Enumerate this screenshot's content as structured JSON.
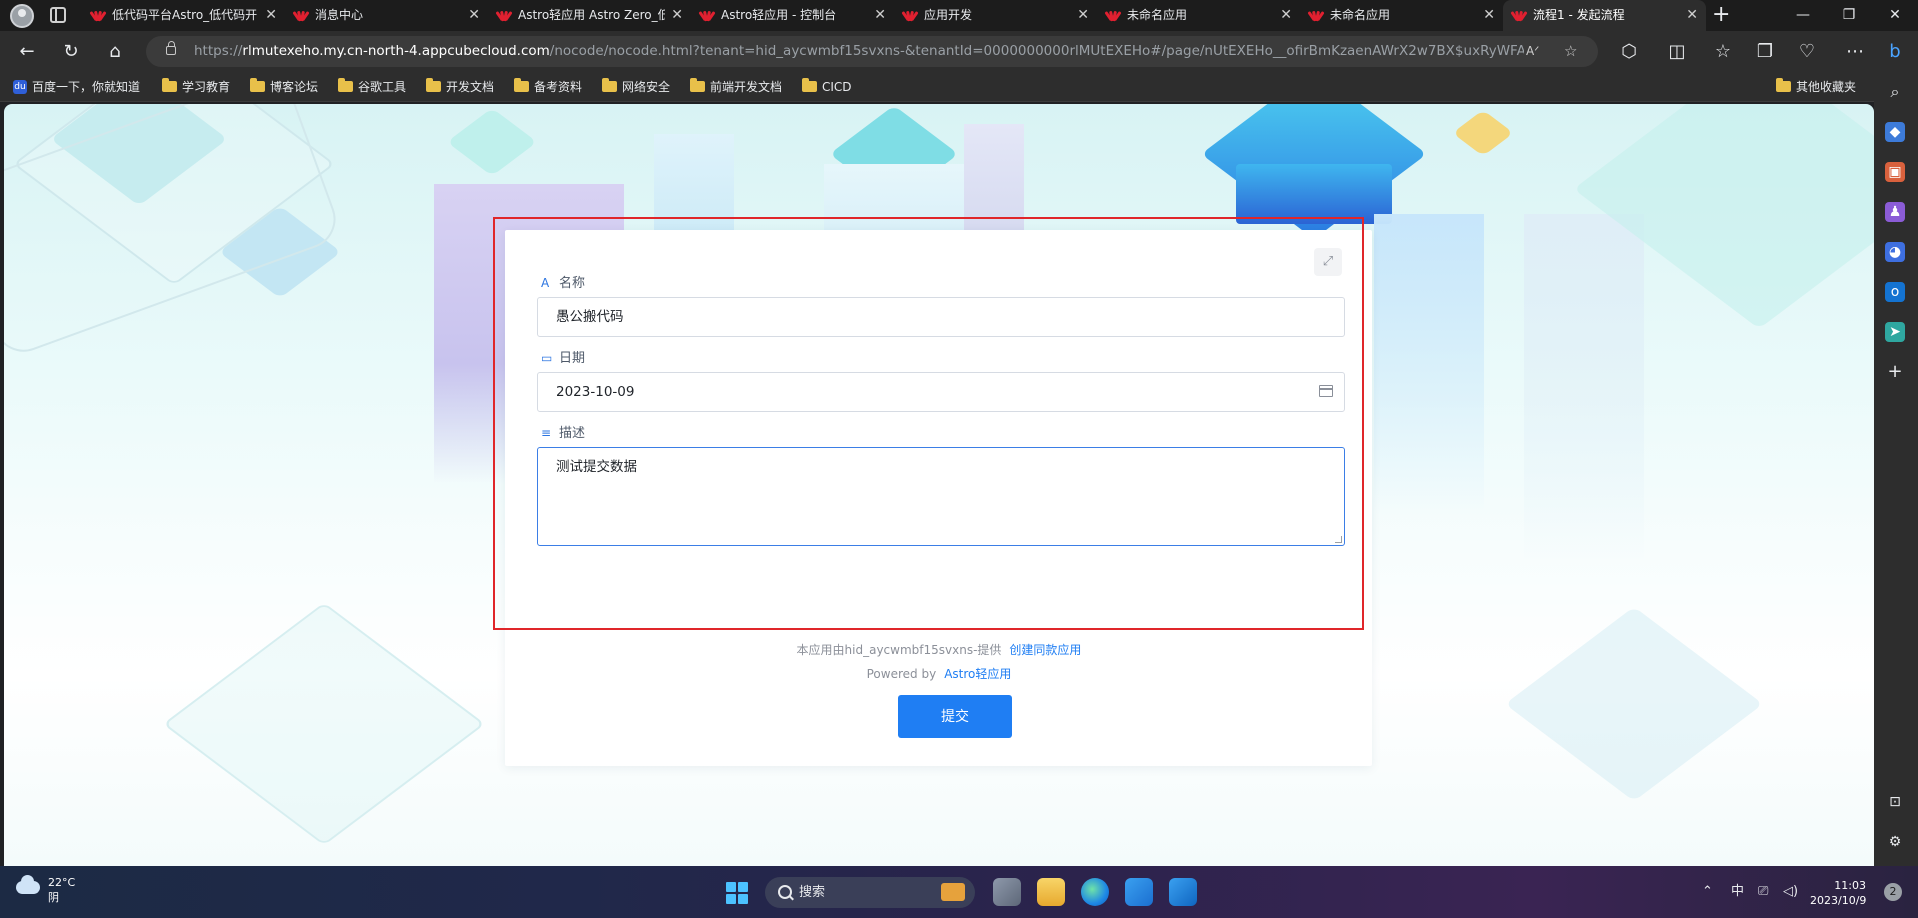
{
  "browser": {
    "tabs": [
      {
        "label": "低代码平台Astro_低代码开",
        "active": false
      },
      {
        "label": "消息中心",
        "active": false
      },
      {
        "label": "Astro轻应用 Astro Zero_低",
        "active": false
      },
      {
        "label": "Astro轻应用 - 控制台",
        "active": false
      },
      {
        "label": "应用开发",
        "active": false
      },
      {
        "label": "未命名应用",
        "active": false
      },
      {
        "label": "未命名应用",
        "active": false
      },
      {
        "label": "流程1 - 发起流程",
        "active": true
      }
    ],
    "tab_close_glyph": "✕",
    "new_tab_glyph": "+",
    "window_buttons": {
      "minimize": "—",
      "restore": "❐",
      "close": "✕"
    },
    "url": {
      "scheme": "https://",
      "host": "rlmutexeho.my.cn-north-4.appcubecloud.com",
      "path": "/nocode/nocode.html?tenant=hid_aycwmbf15svxns-&tenantId=0000000000rlMUtEXEHo#/page/nUtEXEHo__ofirBmKzaenAWrX2w7BX$uxRyWFAWHz$form?typ..."
    },
    "nav_icons": [
      "back-icon",
      "refresh-icon",
      "home-icon"
    ],
    "bookmarks": [
      {
        "label": "百度一下，你就知道",
        "icon": "baidu-icon"
      },
      {
        "label": "学习教育",
        "icon": "folder-icon"
      },
      {
        "label": "博客论坛",
        "icon": "folder-icon"
      },
      {
        "label": "谷歌工具",
        "icon": "folder-icon"
      },
      {
        "label": "开发文档",
        "icon": "folder-icon"
      },
      {
        "label": "备考资料",
        "icon": "folder-icon"
      },
      {
        "label": "网络安全",
        "icon": "folder-icon"
      },
      {
        "label": "前端开发文档",
        "icon": "folder-icon"
      },
      {
        "label": "CICD",
        "icon": "folder-icon"
      }
    ],
    "other_bookmarks": "其他收藏夹"
  },
  "form": {
    "fields": [
      {
        "label": "名称",
        "value": "愚公搬代码",
        "icon": "text-type-icon",
        "icon_glyph": "A"
      },
      {
        "label": "日期",
        "value": "2023-10-09",
        "icon": "calendar-icon",
        "icon_glyph": "▭"
      },
      {
        "label": "描述",
        "value": "测试提交数据",
        "icon": "multiline-text-icon",
        "icon_glyph": "≡"
      }
    ],
    "submit_label": "提交",
    "expand_glyph": "⤢"
  },
  "footer": {
    "provided_by": "本应用由hid_aycwmbf15svxns-提供",
    "create_link": "创建同款应用",
    "powered_by": "Powered by",
    "powered_link": "Astro轻应用"
  },
  "taskbar": {
    "weather_temp": "22°C",
    "weather_desc": "阴",
    "search_placeholder": "搜索",
    "ime": "中",
    "time": "11:03",
    "date": "2023/10/9",
    "notification_count": "2"
  },
  "colors": {
    "accent": "#1f7ef3",
    "highlight_border": "#e0262a",
    "focused_field_border": "#3b7ee6"
  }
}
